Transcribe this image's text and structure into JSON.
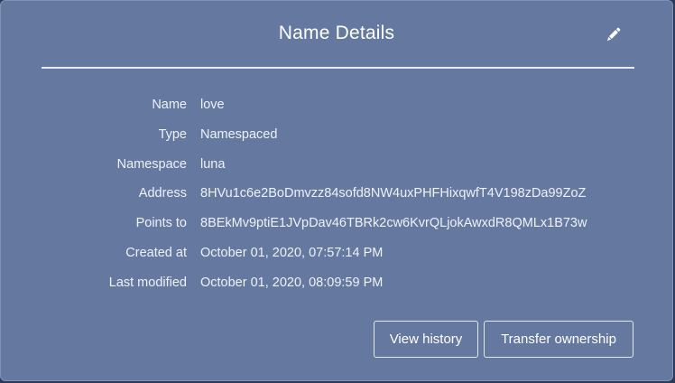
{
  "dialog": {
    "title": "Name Details",
    "edit_icon": "pencil-icon"
  },
  "details": [
    {
      "label": "Name",
      "value": "love"
    },
    {
      "label": "Type",
      "value": "Namespaced"
    },
    {
      "label": "Namespace",
      "value": "luna"
    },
    {
      "label": "Address",
      "value": "8HVu1c6e2BoDmvzz84sofd8NW4uxPHFHixqwfT4V198zDa99ZoZ"
    },
    {
      "label": "Points to",
      "value": "8BEkMv9ptiE1JVpDav46TBRk2cw6KvrQLjokAwxdR8QMLx1B73w"
    },
    {
      "label": "Created at",
      "value": "October 01, 2020, 07:57:14 PM"
    },
    {
      "label": "Last modified",
      "value": "October 01, 2020, 08:09:59 PM"
    }
  ],
  "actions": {
    "view_history": "View history",
    "transfer_ownership": "Transfer ownership"
  },
  "colors": {
    "panel": "#6579a0",
    "text": "#eef1f7",
    "border": "#e3e8f1"
  }
}
